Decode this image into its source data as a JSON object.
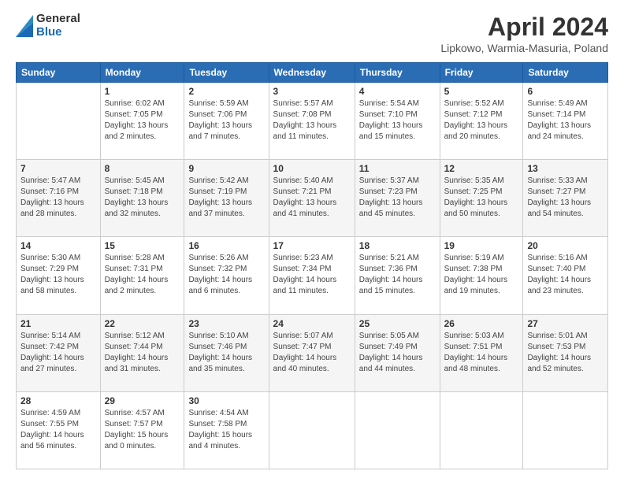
{
  "logo": {
    "general": "General",
    "blue": "Blue"
  },
  "title": "April 2024",
  "location": "Lipkowo, Warmia-Masuria, Poland",
  "days_of_week": [
    "Sunday",
    "Monday",
    "Tuesday",
    "Wednesday",
    "Thursday",
    "Friday",
    "Saturday"
  ],
  "weeks": [
    [
      {
        "day": "",
        "info": ""
      },
      {
        "day": "1",
        "info": "Sunrise: 6:02 AM\nSunset: 7:05 PM\nDaylight: 13 hours\nand 2 minutes."
      },
      {
        "day": "2",
        "info": "Sunrise: 5:59 AM\nSunset: 7:06 PM\nDaylight: 13 hours\nand 7 minutes."
      },
      {
        "day": "3",
        "info": "Sunrise: 5:57 AM\nSunset: 7:08 PM\nDaylight: 13 hours\nand 11 minutes."
      },
      {
        "day": "4",
        "info": "Sunrise: 5:54 AM\nSunset: 7:10 PM\nDaylight: 13 hours\nand 15 minutes."
      },
      {
        "day": "5",
        "info": "Sunrise: 5:52 AM\nSunset: 7:12 PM\nDaylight: 13 hours\nand 20 minutes."
      },
      {
        "day": "6",
        "info": "Sunrise: 5:49 AM\nSunset: 7:14 PM\nDaylight: 13 hours\nand 24 minutes."
      }
    ],
    [
      {
        "day": "7",
        "info": "Sunrise: 5:47 AM\nSunset: 7:16 PM\nDaylight: 13 hours\nand 28 minutes."
      },
      {
        "day": "8",
        "info": "Sunrise: 5:45 AM\nSunset: 7:18 PM\nDaylight: 13 hours\nand 32 minutes."
      },
      {
        "day": "9",
        "info": "Sunrise: 5:42 AM\nSunset: 7:19 PM\nDaylight: 13 hours\nand 37 minutes."
      },
      {
        "day": "10",
        "info": "Sunrise: 5:40 AM\nSunset: 7:21 PM\nDaylight: 13 hours\nand 41 minutes."
      },
      {
        "day": "11",
        "info": "Sunrise: 5:37 AM\nSunset: 7:23 PM\nDaylight: 13 hours\nand 45 minutes."
      },
      {
        "day": "12",
        "info": "Sunrise: 5:35 AM\nSunset: 7:25 PM\nDaylight: 13 hours\nand 50 minutes."
      },
      {
        "day": "13",
        "info": "Sunrise: 5:33 AM\nSunset: 7:27 PM\nDaylight: 13 hours\nand 54 minutes."
      }
    ],
    [
      {
        "day": "14",
        "info": "Sunrise: 5:30 AM\nSunset: 7:29 PM\nDaylight: 13 hours\nand 58 minutes."
      },
      {
        "day": "15",
        "info": "Sunrise: 5:28 AM\nSunset: 7:31 PM\nDaylight: 14 hours\nand 2 minutes."
      },
      {
        "day": "16",
        "info": "Sunrise: 5:26 AM\nSunset: 7:32 PM\nDaylight: 14 hours\nand 6 minutes."
      },
      {
        "day": "17",
        "info": "Sunrise: 5:23 AM\nSunset: 7:34 PM\nDaylight: 14 hours\nand 11 minutes."
      },
      {
        "day": "18",
        "info": "Sunrise: 5:21 AM\nSunset: 7:36 PM\nDaylight: 14 hours\nand 15 minutes."
      },
      {
        "day": "19",
        "info": "Sunrise: 5:19 AM\nSunset: 7:38 PM\nDaylight: 14 hours\nand 19 minutes."
      },
      {
        "day": "20",
        "info": "Sunrise: 5:16 AM\nSunset: 7:40 PM\nDaylight: 14 hours\nand 23 minutes."
      }
    ],
    [
      {
        "day": "21",
        "info": "Sunrise: 5:14 AM\nSunset: 7:42 PM\nDaylight: 14 hours\nand 27 minutes."
      },
      {
        "day": "22",
        "info": "Sunrise: 5:12 AM\nSunset: 7:44 PM\nDaylight: 14 hours\nand 31 minutes."
      },
      {
        "day": "23",
        "info": "Sunrise: 5:10 AM\nSunset: 7:46 PM\nDaylight: 14 hours\nand 35 minutes."
      },
      {
        "day": "24",
        "info": "Sunrise: 5:07 AM\nSunset: 7:47 PM\nDaylight: 14 hours\nand 40 minutes."
      },
      {
        "day": "25",
        "info": "Sunrise: 5:05 AM\nSunset: 7:49 PM\nDaylight: 14 hours\nand 44 minutes."
      },
      {
        "day": "26",
        "info": "Sunrise: 5:03 AM\nSunset: 7:51 PM\nDaylight: 14 hours\nand 48 minutes."
      },
      {
        "day": "27",
        "info": "Sunrise: 5:01 AM\nSunset: 7:53 PM\nDaylight: 14 hours\nand 52 minutes."
      }
    ],
    [
      {
        "day": "28",
        "info": "Sunrise: 4:59 AM\nSunset: 7:55 PM\nDaylight: 14 hours\nand 56 minutes."
      },
      {
        "day": "29",
        "info": "Sunrise: 4:57 AM\nSunset: 7:57 PM\nDaylight: 15 hours\nand 0 minutes."
      },
      {
        "day": "30",
        "info": "Sunrise: 4:54 AM\nSunset: 7:58 PM\nDaylight: 15 hours\nand 4 minutes."
      },
      {
        "day": "",
        "info": ""
      },
      {
        "day": "",
        "info": ""
      },
      {
        "day": "",
        "info": ""
      },
      {
        "day": "",
        "info": ""
      }
    ]
  ]
}
